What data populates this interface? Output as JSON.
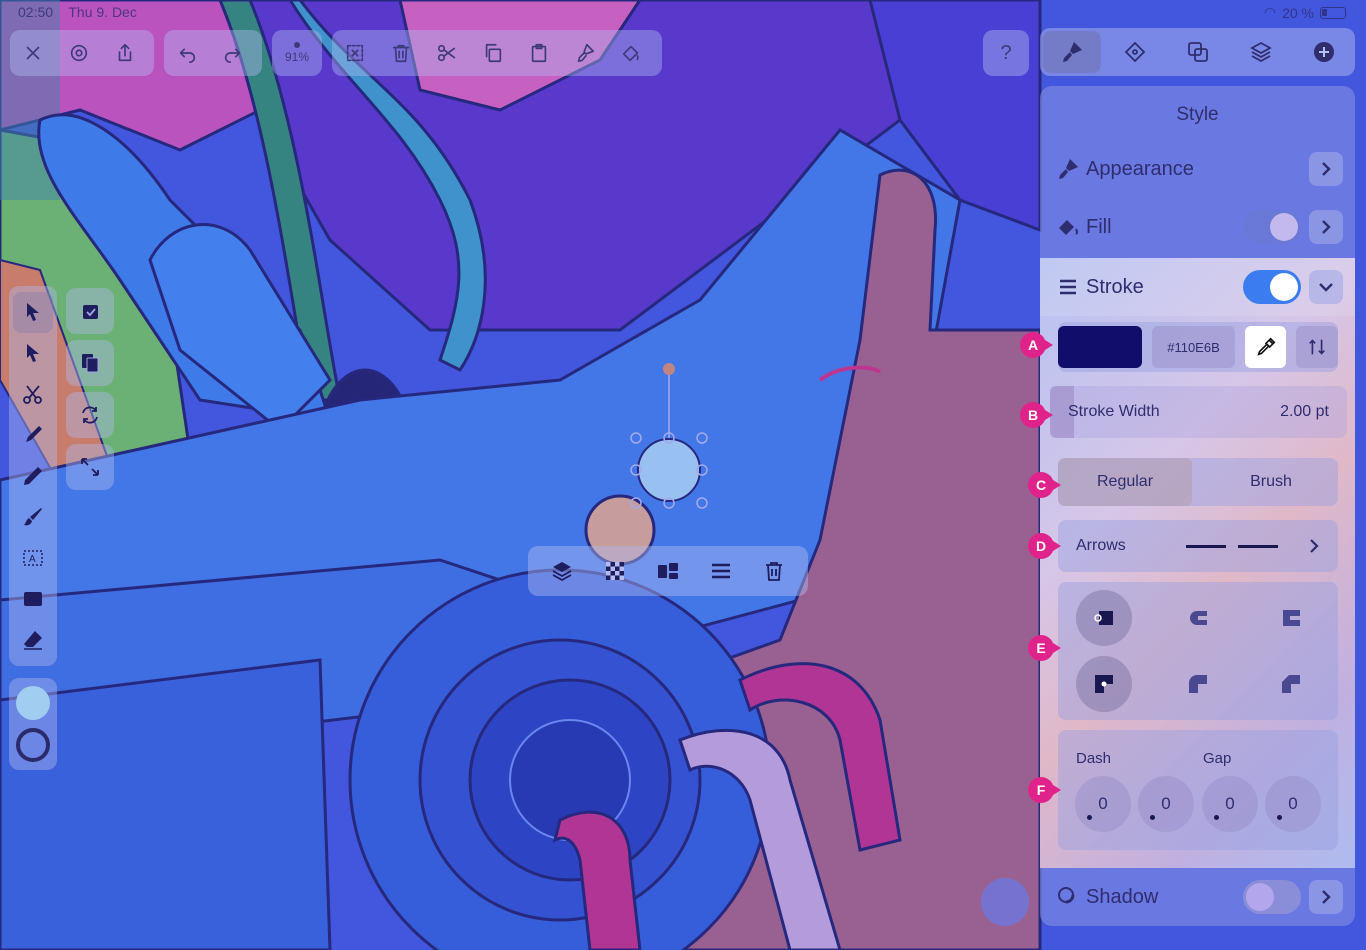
{
  "status_bar": {
    "time": "02:50",
    "date": "Thu 9. Dec",
    "battery": "20 %"
  },
  "top_toolbar": {
    "zoom_label": "91%",
    "icons": [
      "close-icon",
      "settings-icon",
      "share-icon",
      "undo-icon",
      "redo-icon",
      "zoom-icon",
      "deselect-icon",
      "trash-icon",
      "scissors-icon",
      "copy-icon",
      "paste-icon",
      "style-brush-icon",
      "fill-bucket-icon"
    ]
  },
  "help_label": "?",
  "panel_tabs": [
    "style-icon",
    "shape-icon",
    "arrange-icon",
    "layers-icon",
    "add-icon"
  ],
  "style_panel": {
    "title": "Style",
    "appearance": {
      "label": "Appearance"
    },
    "fill": {
      "label": "Fill",
      "enabled": true
    },
    "stroke": {
      "label": "Stroke",
      "enabled": true,
      "expanded": true
    },
    "color": {
      "hex": "#110E6B",
      "swatch": "#110E6B"
    },
    "stroke_width": {
      "label": "Stroke Width",
      "value": "2.00 pt"
    },
    "stroke_type": {
      "options": [
        "Regular",
        "Brush"
      ],
      "selected": "Regular"
    },
    "arrows": {
      "label": "Arrows"
    },
    "dash_gap": {
      "dash_label": "Dash",
      "gap_label": "Gap",
      "values": [
        "0",
        "0",
        "0",
        "0"
      ]
    },
    "shadow": {
      "label": "Shadow",
      "enabled": false
    }
  },
  "markers": [
    "A",
    "B",
    "C",
    "D",
    "E",
    "F"
  ],
  "left_tools": [
    "select-icon",
    "direct-select-icon",
    "scissors-icon",
    "pen-icon",
    "pencil-icon",
    "brush-icon",
    "text-icon",
    "shape-icon",
    "eraser-icon"
  ],
  "colors": {
    "fill_swatch": "#a0cdf0",
    "stroke_swatch": "#2c2a6b"
  }
}
